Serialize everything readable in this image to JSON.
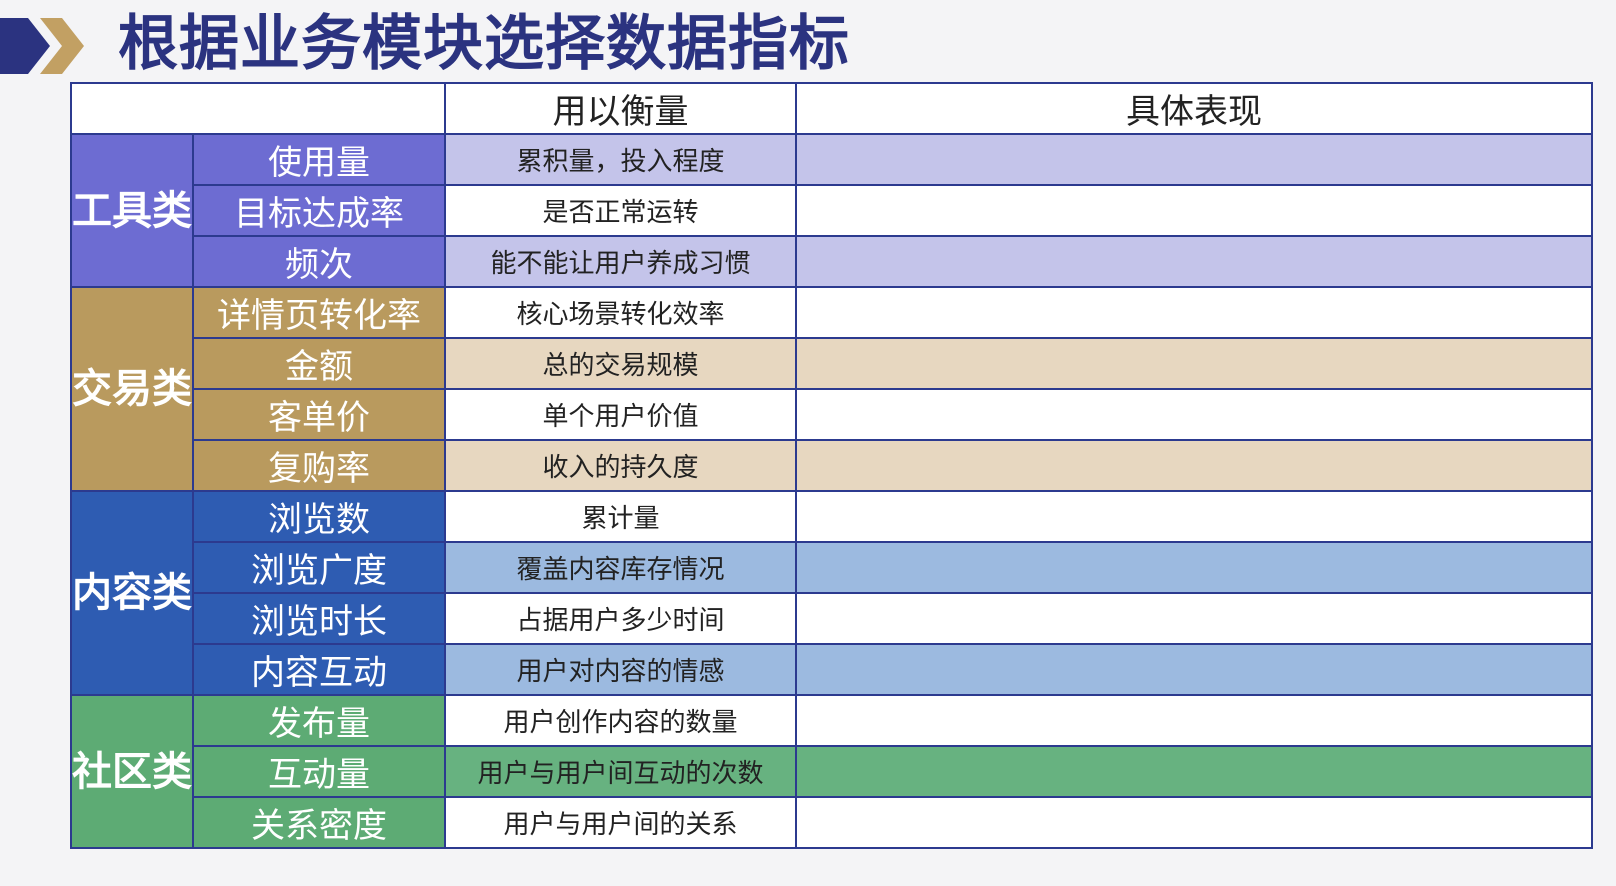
{
  "title": "根据业务模块选择数据指标",
  "table": {
    "headers": [
      "",
      "用以衡量",
      "具体表现"
    ],
    "groups": [
      {
        "category": "工具类",
        "rows": [
          {
            "metric": "使用量",
            "measure": "累积量，投入程度",
            "detail": ""
          },
          {
            "metric": "目标达成率",
            "measure": "是否正常运转",
            "detail": ""
          },
          {
            "metric": "频次",
            "measure": "能不能让用户养成习惯",
            "detail": ""
          }
        ]
      },
      {
        "category": "交易类",
        "rows": [
          {
            "metric": "详情页转化率",
            "measure": "核心场景转化效率",
            "detail": ""
          },
          {
            "metric": "金额",
            "measure": "总的交易规模",
            "detail": ""
          },
          {
            "metric": "客单价",
            "measure": "单个用户价值",
            "detail": ""
          },
          {
            "metric": "复购率",
            "measure": "收入的持久度",
            "detail": ""
          }
        ]
      },
      {
        "category": "内容类",
        "rows": [
          {
            "metric": "浏览数",
            "measure": "累计量",
            "detail": ""
          },
          {
            "metric": "浏览广度",
            "measure": "覆盖内容库存情况",
            "detail": ""
          },
          {
            "metric": "浏览时长",
            "measure": "占据用户多少时间",
            "detail": ""
          },
          {
            "metric": "内容互动",
            "measure": "用户对内容的情感",
            "detail": ""
          }
        ]
      },
      {
        "category": "社区类",
        "rows": [
          {
            "metric": "发布量",
            "measure": "用户创作内容的数量",
            "detail": ""
          },
          {
            "metric": "互动量",
            "measure": "用户与用户间互动的次数",
            "detail": ""
          },
          {
            "metric": "关系密度",
            "measure": "用户与用户间的关系",
            "detail": ""
          }
        ]
      }
    ]
  },
  "colors": {
    "title": "#2b3380",
    "border": "#2c3a8f",
    "tool": "#6d6cd2",
    "trade": "#b99a5e",
    "content": "#2e5cb2",
    "social": "#5dab74"
  },
  "icons": {
    "header_chevrons": "double-chevron-right"
  }
}
